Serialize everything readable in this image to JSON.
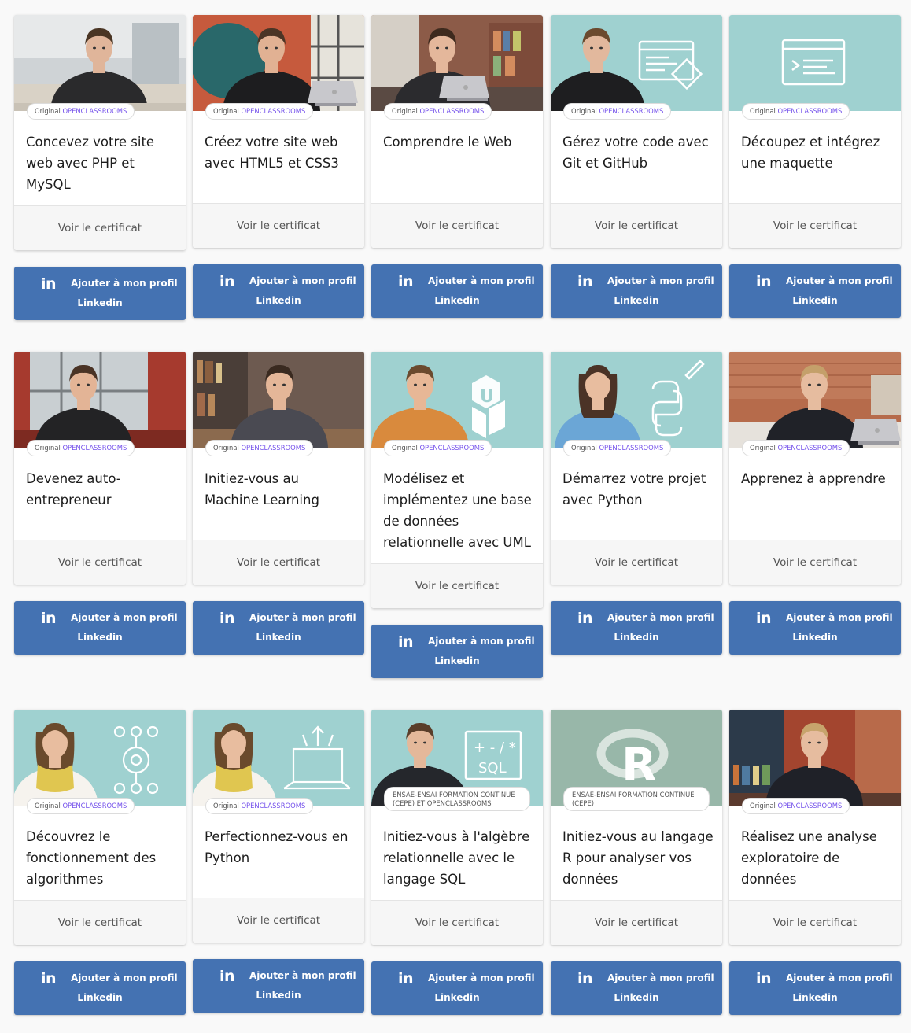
{
  "badge_original": "Original",
  "badge_brand": "OPENCLASSROOMS",
  "cert_label": "Voir le certificat",
  "linkedin": {
    "icon": "in",
    "line1": "Ajouter à mon profil",
    "line2": "Linkedin"
  },
  "colors": {
    "accent": "#4472b2",
    "brand": "#7451eb",
    "teal": "#9fd1d0"
  },
  "courses": [
    {
      "title": "Concevez votre site web avec PHP et MySQL"
    },
    {
      "title": "Créez votre site web avec HTML5 et CSS3"
    },
    {
      "title": "Comprendre le Web"
    },
    {
      "title": "Gérez votre code avec Git et GitHub"
    },
    {
      "title": "Découpez et intégrez une maquette"
    },
    {
      "title": "Devenez auto-entrepreneur"
    },
    {
      "title": "Initiez-vous au Machine Learning"
    },
    {
      "title": "Modélisez et implémentez une base de données relationnelle avec UML"
    },
    {
      "title": "Démarrez votre projet avec Python"
    },
    {
      "title": "Apprenez à apprendre"
    },
    {
      "title": "Découvrez le fonctionnement des algorithmes"
    },
    {
      "title": "Perfectionnez-vous en Python"
    },
    {
      "title": "Initiez-vous à l'algèbre relationnelle avec le langage SQL",
      "badge": "ENSAE-ENSAI FORMATION CONTINUE (CEPE) ET OPENCLASSROOMS"
    },
    {
      "title": "Initiez-vous au langage R pour analyser vos données",
      "badge": "ENSAE-ENSAI FORMATION CONTINUE (CEPE)"
    },
    {
      "title": "Réalisez une analyse exploratoire de données"
    }
  ]
}
